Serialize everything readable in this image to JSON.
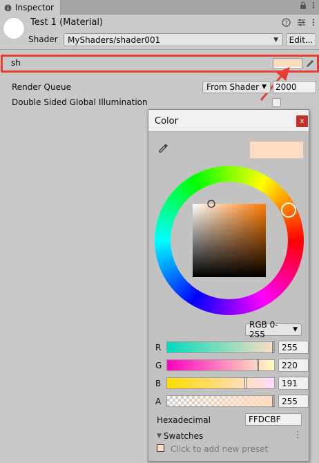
{
  "tab": {
    "label": "Inspector",
    "icon": "info-icon"
  },
  "material": {
    "title": "Test 1 (Material)",
    "shader_label": "Shader",
    "shader_value": "MyShaders/shader001",
    "edit_label": "Edit..."
  },
  "property": {
    "label": "sh",
    "color": "#ffdcbf"
  },
  "render_queue": {
    "label": "Render Queue",
    "mode": "From Shader",
    "value": "2000"
  },
  "dsgi": {
    "label": "Double Sided Global Illumination",
    "checked": false
  },
  "color_window": {
    "title": "Color",
    "close_label": "x",
    "preview_color": "#ffdcbf",
    "mode": "RGB 0-255",
    "channels": [
      {
        "label": "R",
        "value": "255"
      },
      {
        "label": "G",
        "value": "220"
      },
      {
        "label": "B",
        "value": "191"
      },
      {
        "label": "A",
        "value": "255"
      }
    ],
    "hex_label": "Hexadecimal",
    "hex_value": "FFDCBF",
    "swatches_label": "Swatches",
    "swatches_hint": "Click to add new preset"
  },
  "colors": {
    "annotation": "#e53d30",
    "close_button": "#c4302b"
  }
}
